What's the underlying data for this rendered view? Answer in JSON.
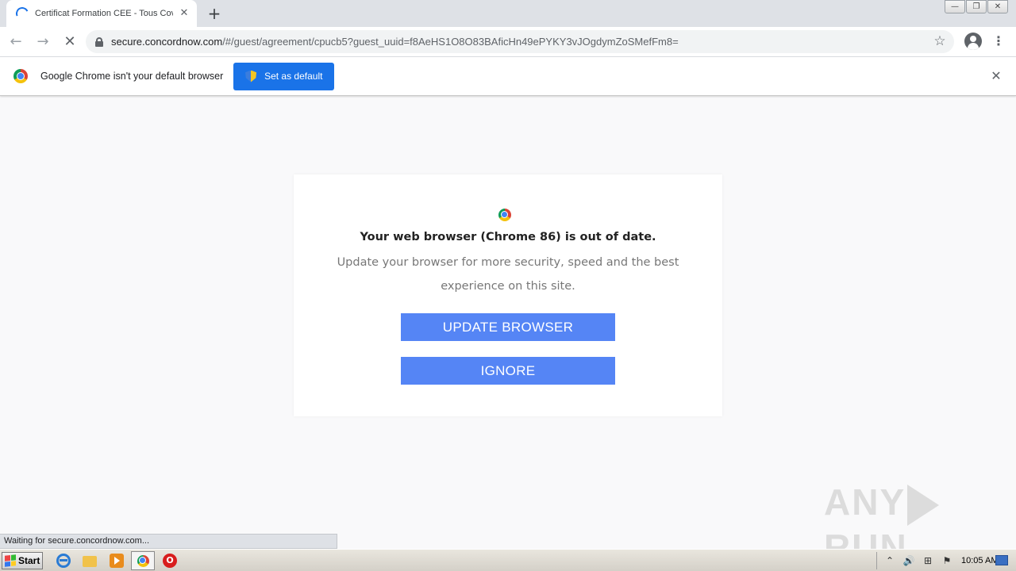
{
  "tab": {
    "title": "Certificat Formation CEE - Tous Cov",
    "close_glyph": "✕",
    "new_tab_glyph": "+"
  },
  "window_controls": [
    "—",
    "❐",
    "✕"
  ],
  "toolbar": {
    "back_glyph": "←",
    "forward_glyph": "→",
    "stop_glyph": "✕",
    "url_host": "secure.concordnow.com",
    "url_path": "/#/guest/agreement/cpucb5?guest_uuid=f8AeHS1O8O83BAficHn49ePYKY3vJOgdymZoSMefFm8=",
    "star_glyph": "☆",
    "menu_glyph": "⋮"
  },
  "infobar": {
    "message": "Google Chrome isn't your default browser",
    "button_label": "Set as default",
    "close_glyph": "✕"
  },
  "dialog": {
    "headline": "Your web browser (Chrome 86) is out of date.",
    "subtext": "Update your browser for more security, speed and the best experience on this site.",
    "update_label": "UPDATE BROWSER",
    "ignore_label": "IGNORE"
  },
  "watermark": {
    "left": "ANY",
    "right": "RUN"
  },
  "status_bubble": "Waiting for secure.concordnow.com...",
  "taskbar": {
    "start_label": "Start",
    "opera_glyph": "O",
    "clock": "10:05 AM",
    "tray_icons": [
      "⌃",
      "🔊",
      "⊞",
      "⚑"
    ]
  },
  "colors": {
    "accent": "#1a73e8",
    "cta": "#5585f5",
    "page_bg": "#f9f9fa"
  }
}
